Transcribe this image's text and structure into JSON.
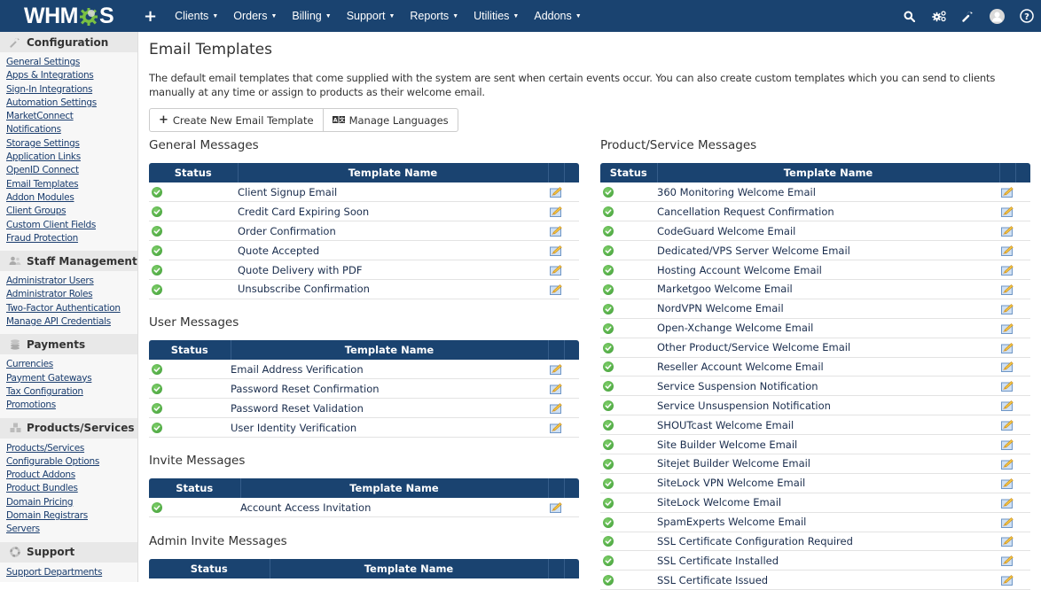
{
  "brand": {
    "logo_text_left": "WHM",
    "logo_text_right": "S",
    "primary_color": "#1a4370",
    "gear_color": "#7ac143"
  },
  "nav": {
    "add_label": "+",
    "menus": [
      "Clients",
      "Orders",
      "Billing",
      "Support",
      "Reports",
      "Utilities",
      "Addons"
    ],
    "right_icons": [
      "search-icon",
      "automation-gears-icon",
      "wrench-icon",
      "user-avatar-icon",
      "help-icon"
    ]
  },
  "sidebar": {
    "sections": [
      {
        "title": "Configuration",
        "icon": "wrench-icon",
        "links": [
          "General Settings",
          "Apps & Integrations",
          "Sign-In Integrations",
          "Automation Settings",
          "MarketConnect",
          "Notifications",
          "Storage Settings",
          "Application Links",
          "OpenID Connect",
          "Email Templates",
          "Addon Modules",
          "Client Groups",
          "Custom Client Fields",
          "Fraud Protection"
        ]
      },
      {
        "title": "Staff Management",
        "icon": "users-icon",
        "links": [
          "Administrator Users",
          "Administrator Roles",
          "Two-Factor Authentication",
          "Manage API Credentials"
        ]
      },
      {
        "title": "Payments",
        "icon": "coins-icon",
        "links": [
          "Currencies",
          "Payment Gateways",
          "Tax Configuration",
          "Promotions"
        ]
      },
      {
        "title": "Products/Services",
        "icon": "cubes-icon",
        "links": [
          "Products/Services",
          "Configurable Options",
          "Product Addons",
          "Product Bundles",
          "Domain Pricing",
          "Domain Registrars",
          "Servers"
        ]
      },
      {
        "title": "Support",
        "icon": "lifering-icon",
        "links": [
          "Support Departments"
        ]
      }
    ]
  },
  "main": {
    "title": "Email Templates",
    "description": "The default email templates that come supplied with the system are sent when certain events occur. You can also create custom templates which you can send to clients manually at any time or assign to products as their welcome email.",
    "buttons": {
      "create": "Create New Email Template",
      "languages": "Manage Languages"
    },
    "columns": {
      "status": "Status",
      "name": "Template Name"
    },
    "groups": {
      "general": {
        "title": "General Messages",
        "rows": [
          "Client Signup Email",
          "Credit Card Expiring Soon",
          "Order Confirmation",
          "Quote Accepted",
          "Quote Delivery with PDF",
          "Unsubscribe Confirmation"
        ]
      },
      "user": {
        "title": "User Messages",
        "rows": [
          "Email Address Verification",
          "Password Reset Confirmation",
          "Password Reset Validation",
          "User Identity Verification"
        ]
      },
      "invite": {
        "title": "Invite Messages",
        "rows": [
          "Account Access Invitation"
        ]
      },
      "admin_invite": {
        "title": "Admin Invite Messages",
        "rows": []
      },
      "product": {
        "title": "Product/Service Messages",
        "rows": [
          "360 Monitoring Welcome Email",
          "Cancellation Request Confirmation",
          "CodeGuard Welcome Email",
          "Dedicated/VPS Server Welcome Email",
          "Hosting Account Welcome Email",
          "Marketgoo Welcome Email",
          "NordVPN Welcome Email",
          "Open-Xchange Welcome Email",
          "Other Product/Service Welcome Email",
          "Reseller Account Welcome Email",
          "Service Suspension Notification",
          "Service Unsuspension Notification",
          "SHOUTcast Welcome Email",
          "Site Builder Welcome Email",
          "Sitejet Builder Welcome Email",
          "SiteLock VPN Welcome Email",
          "SiteLock Welcome Email",
          "SpamExperts Welcome Email",
          "SSL Certificate Configuration Required",
          "SSL Certificate Installed",
          "SSL Certificate Issued"
        ]
      }
    },
    "row_status": "active"
  }
}
